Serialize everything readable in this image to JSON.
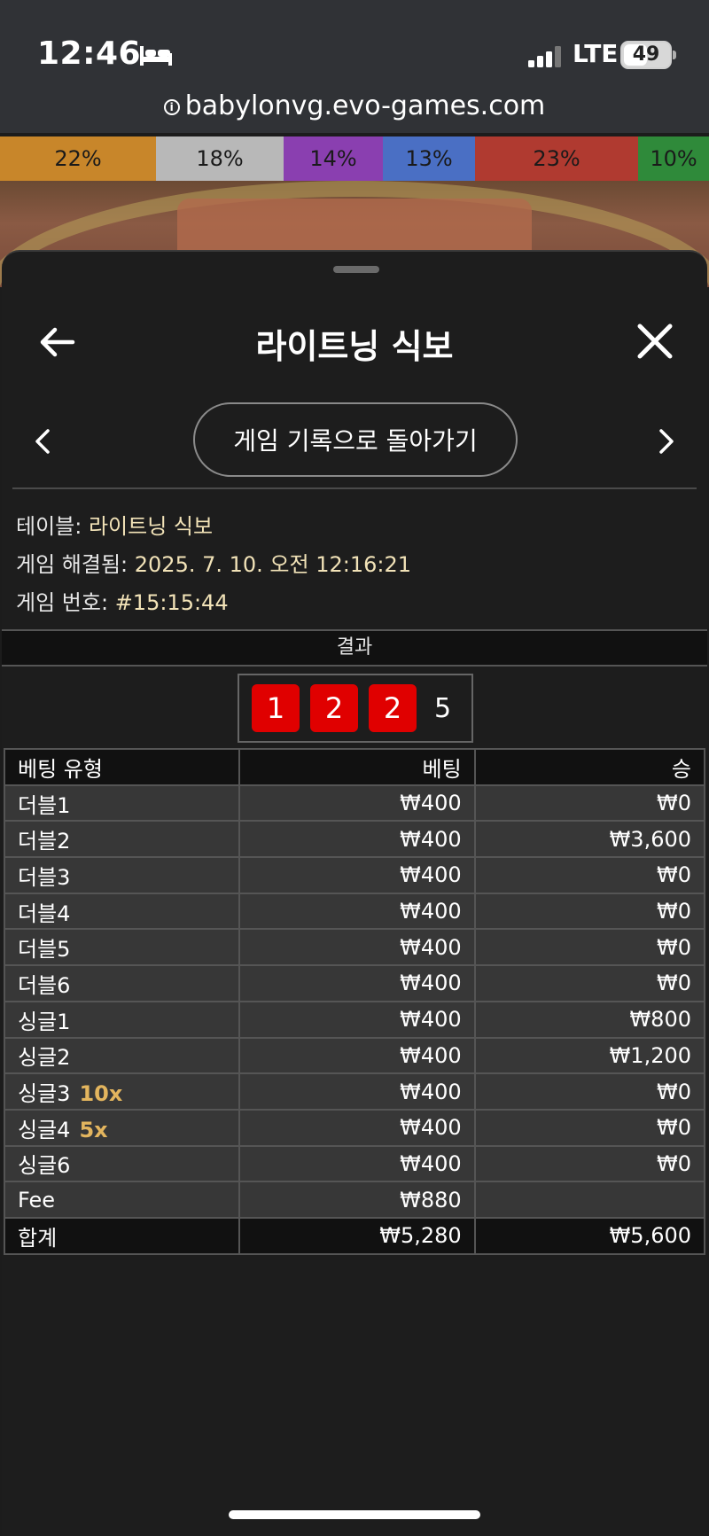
{
  "status_bar": {
    "time": "12:46",
    "network": "LTE",
    "battery": "49",
    "battery_level": 0.49
  },
  "browser": {
    "url": "babylonvg.evo-games.com"
  },
  "percent_strip": [
    {
      "label": "22%",
      "color": "#c8862a"
    },
    {
      "label": "18%",
      "color": "#b8b8b8"
    },
    {
      "label": "14%",
      "color": "#8a3fb0"
    },
    {
      "label": "13%",
      "color": "#4a6fc4"
    },
    {
      "label": "23%",
      "color": "#b03a30"
    },
    {
      "label": "10%",
      "color": "#2f8a3a"
    }
  ],
  "panel": {
    "title": "라이트닝 식보",
    "history_button": "게임 기록으로 돌아가기"
  },
  "info": {
    "table_label": "테이블:",
    "table_value": "라이트닝 식보",
    "resolved_label": "게임 해결됨:",
    "resolved_value": "2025. 7. 10. 오전 12:16:21",
    "game_no_label": "게임 번호:",
    "game_no_value": "#15:15:44"
  },
  "result": {
    "header": "결과",
    "dice": [
      "1",
      "2",
      "2"
    ],
    "total": "5"
  },
  "table": {
    "headers": {
      "type": "베팅 유형",
      "bet": "베팅",
      "win": "승"
    },
    "rows": [
      {
        "type": "더블1",
        "mult": "",
        "bet": "₩400",
        "win": "₩0"
      },
      {
        "type": "더블2",
        "mult": "",
        "bet": "₩400",
        "win": "₩3,600"
      },
      {
        "type": "더블3",
        "mult": "",
        "bet": "₩400",
        "win": "₩0"
      },
      {
        "type": "더블4",
        "mult": "",
        "bet": "₩400",
        "win": "₩0"
      },
      {
        "type": "더블5",
        "mult": "",
        "bet": "₩400",
        "win": "₩0"
      },
      {
        "type": "더블6",
        "mult": "",
        "bet": "₩400",
        "win": "₩0"
      },
      {
        "type": "싱글1",
        "mult": "",
        "bet": "₩400",
        "win": "₩800"
      },
      {
        "type": "싱글2",
        "mult": "",
        "bet": "₩400",
        "win": "₩1,200"
      },
      {
        "type": "싱글3",
        "mult": "10x",
        "bet": "₩400",
        "win": "₩0"
      },
      {
        "type": "싱글4",
        "mult": "5x",
        "bet": "₩400",
        "win": "₩0"
      },
      {
        "type": "싱글6",
        "mult": "",
        "bet": "₩400",
        "win": "₩0"
      },
      {
        "type": "Fee",
        "mult": "",
        "bet": "₩880",
        "win": ""
      }
    ],
    "total": {
      "type": "합계",
      "bet": "₩5,280",
      "win": "₩5,600"
    }
  }
}
